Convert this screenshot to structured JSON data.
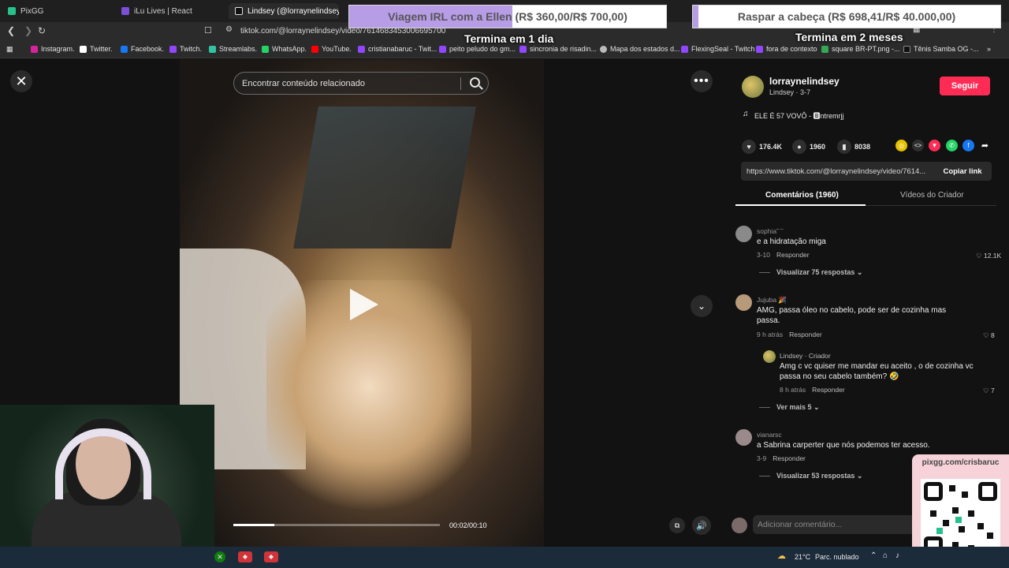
{
  "tabs": [
    {
      "label": "PixGG"
    },
    {
      "label": "iLu Lives | React"
    },
    {
      "label": "Lindsey (@lorraynelindsey"
    }
  ],
  "url": "tiktok.com/@lorraynelindsey/video/7614683453006695700",
  "bookmarks": [
    "Instagram.",
    "Twitter.",
    "Facebook.",
    "Twitch.",
    "Streamlabs.",
    "WhatsApp.",
    "YouTube.",
    "cristianabaruc - Twit...",
    "peito peludo do gm...",
    "sincronia de risadin...",
    "Mapa dos estados d...",
    "FlexingSeal - Twitch",
    "fora de contexto",
    "square BR-PT.png -...",
    "Tênis Samba OG -..."
  ],
  "goals": [
    {
      "text": "Viagem IRL com a Ellen (R$ 360,00/R$ 700,00)",
      "sub": "Termina em 1 dia",
      "progress": 0.514
    },
    {
      "text": "Raspar a cabeça (R$ 698,41/R$ 40.000,00)",
      "sub": "Termina em 2 meses",
      "progress": 0.017
    }
  ],
  "video": {
    "search_placeholder": "Encontrar conteúdo relacionado",
    "time": "00:02/00:10",
    "progress": 0.2
  },
  "author": {
    "username": "lorraynelindsey",
    "subtitle": "Lindsey · 3-7",
    "follow_label": "Seguir",
    "music": "ELE É 57 VOVÔ - 🅱ntremrjj"
  },
  "stats": {
    "likes": "176.4K",
    "comments": "1960",
    "saves": "8038"
  },
  "link": {
    "url": "https://www.tiktok.com/@lorraynelindsey/video/7614...",
    "copy_label": "Copiar link"
  },
  "panel_tabs": [
    {
      "label": "Comentários (1960)"
    },
    {
      "label": "Vídeos do Criador"
    }
  ],
  "comments": [
    {
      "name": "sophia˜ ̈ ̈",
      "text": "e a hidratação miga",
      "time": "3-10",
      "reply": "Responder",
      "likes": "12.1K",
      "view": "Visualizar 75 respostas"
    },
    {
      "name": "Jujuba 🎉",
      "text": "AMG, passa óleo no cabelo, pode ser de cozinha mas passa.",
      "time": "9 h atrás",
      "reply": "Responder",
      "likes": "8"
    },
    {
      "name": "Lindsey · Criador",
      "text": "Amg c vc quiser me mandar eu aceito , o de cozinha vc passa no seu cabelo também? 🤣",
      "time": "8 h atrás",
      "reply": "Responder",
      "likes": "7",
      "view": "Ver mais 5"
    },
    {
      "name": "vianarsc",
      "text": "a Sabrina carperter que nós podemos ter acesso.",
      "time": "3-9",
      "reply": "Responder",
      "view": "Visualizar 53 respostas"
    }
  ],
  "add_comment_placeholder": "Adicionar comentário...",
  "qr_label": "pixgg.com/crisbaruc",
  "taskbar": {
    "weather": "21°C",
    "weather_desc": "Parc. nublado"
  },
  "colors": {
    "accent": "#fe2c55",
    "goal_fill": "#b79ce6",
    "qr_bg": "#f7d3d9"
  }
}
